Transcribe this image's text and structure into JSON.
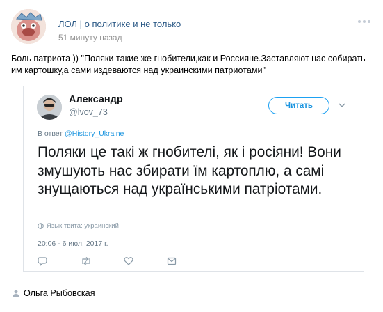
{
  "post": {
    "author": "ЛОЛ | о политике и не только",
    "time": "51 минуту назад",
    "text": "Боль патриота )) \"Поляки такие же гнобители,как и Россияне.Заставляют нас собирать им картошку,а сами издеваются над украинскими патриотами\""
  },
  "tweet": {
    "name": "Александр",
    "handle": "@lvov_73",
    "follow_label": "Читать",
    "reply_prefix": "В ответ",
    "reply_handle": "@History_Ukraine",
    "body": "Поляки це такі ж гнобителі, як і росіяни! Вони змушують нас збирати їм картоплю, а самі знущаються над українськими патріотами.",
    "language": "Язык твита: украинский",
    "date": "20:06 - 6 июл. 2017 г."
  },
  "footer": {
    "source_author": "Ольга Рыбовская"
  },
  "colors": {
    "link": "#2a5885",
    "twitter_blue": "#1da1f2",
    "muted": "#939393"
  }
}
